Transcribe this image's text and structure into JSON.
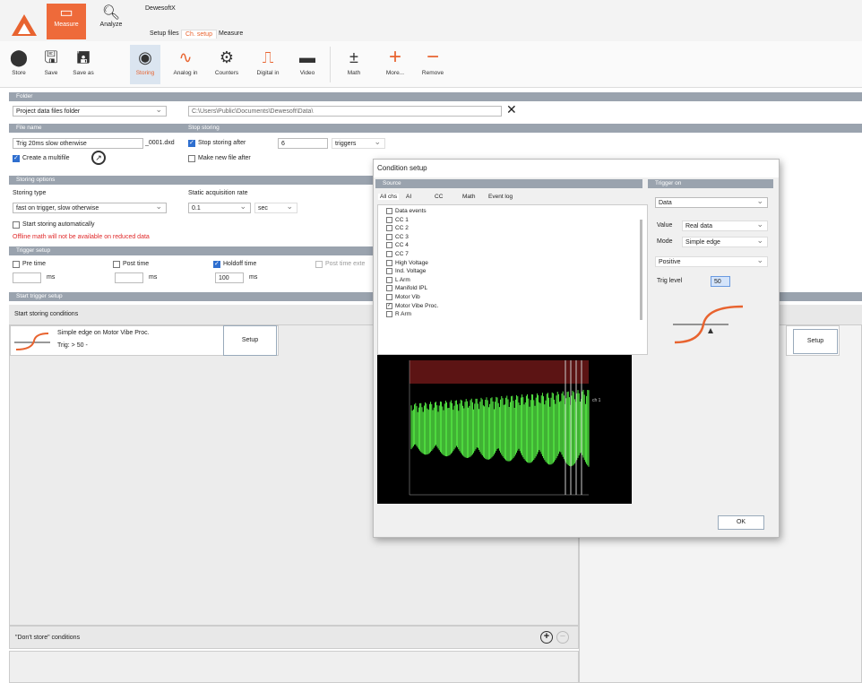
{
  "app": {
    "title": "DewesoftX",
    "main_tabs": [
      {
        "label": "Measure",
        "icon": "measure-icon",
        "active": true
      },
      {
        "label": "Analyze",
        "icon": "magnifier-icon",
        "active": false
      }
    ],
    "sub_tabs": [
      "Setup files",
      "Ch. setup",
      "Measure"
    ],
    "active_sub_tab": "Ch. setup",
    "accent_color": "#ee6a3a"
  },
  "toolbar": {
    "items": [
      {
        "label": "Store",
        "icon": "record-icon"
      },
      {
        "label": "Save",
        "icon": "save-icon"
      },
      {
        "label": "Save as",
        "icon": "save-as-icon"
      },
      {
        "label": "Storing",
        "icon": "storing-icon",
        "active": true
      },
      {
        "label": "Analog in",
        "icon": "analog-wave-icon"
      },
      {
        "label": "Counters",
        "icon": "gear-icon"
      },
      {
        "label": "Digital in",
        "icon": "digital-icon"
      },
      {
        "label": "Video",
        "icon": "camera-icon"
      },
      {
        "label": "Math",
        "icon": "math-icon"
      },
      {
        "label": "More...",
        "icon": "plus-icon"
      },
      {
        "label": "Remove",
        "icon": "minus-icon"
      }
    ]
  },
  "folder": {
    "section": "Folder",
    "folder_type": "Project data files folder",
    "path": "C:\\Users\\Public\\Documents\\Dewesoft\\Data\\"
  },
  "file_name": {
    "section": "File name",
    "name": "Trig 20ms slow otherwise",
    "suffix": "_0001.dxd",
    "create_multifile": "Create a multifile"
  },
  "stop_storing": {
    "section": "Stop storing",
    "stop_label": "Stop storing after",
    "count": "6",
    "unit": "triggers",
    "new_file_after": "Make new file after"
  },
  "storing_options": {
    "section": "Storing options",
    "type_label": "Storing type",
    "type_value": "fast on trigger, slow otherwise",
    "static_label": "Static acquisition rate",
    "static_value": "0.1",
    "static_unit": "sec",
    "auto_start": "Start storing automatically",
    "warning": "Offline math will not be available on reduced data"
  },
  "trigger_setup": {
    "section": "Trigger setup",
    "pre_time": "Pre time",
    "pre_value": "",
    "post_time": "Post time",
    "post_value": "",
    "holdoff_time": "Holdoff time",
    "holdoff_value": "100",
    "ms": "ms",
    "post_time_ext": "Post time exte"
  },
  "start_trigger": {
    "section": "Start trigger setup",
    "conditions_label": "Start storing conditions",
    "condition_line1": "Simple edge on Motor Vibe Proc.",
    "condition_line2": "Trig: > 50 -",
    "setup_button": "Setup",
    "right_setup_button": "Setup"
  },
  "dont_store": {
    "label": "\"Don't store\" conditions"
  },
  "dialog": {
    "title": "Condition setup",
    "source_section": "Source",
    "trigger_on_section": "Trigger on",
    "tabs": [
      "All chs",
      "AI",
      "CC",
      "Math",
      "Event log"
    ],
    "channels": [
      {
        "name": "Data events",
        "checked": false
      },
      {
        "name": "CC 1",
        "checked": false
      },
      {
        "name": "CC 2",
        "checked": false
      },
      {
        "name": "CC 3",
        "checked": false
      },
      {
        "name": "CC 4",
        "checked": false
      },
      {
        "name": "CC 7",
        "checked": false
      },
      {
        "name": "High Voltage",
        "checked": false
      },
      {
        "name": "Ind. Voltage",
        "checked": false
      },
      {
        "name": "L Arm",
        "checked": false
      },
      {
        "name": "Manifold IPL",
        "checked": false
      },
      {
        "name": "Motor Vib",
        "checked": false
      },
      {
        "name": "Motor Vibe Proc.",
        "checked": true
      },
      {
        "name": "R Arm",
        "checked": false
      }
    ],
    "trigger_on": "Data",
    "value_label": "Value",
    "value_value": "Real data",
    "mode_label": "Mode",
    "mode_value": "Simple edge",
    "slope_value": "Positive",
    "trig_level_label": "Trig level",
    "trig_level_value": "50",
    "chart_right_label": "ch 1",
    "ok_button": "OK"
  }
}
